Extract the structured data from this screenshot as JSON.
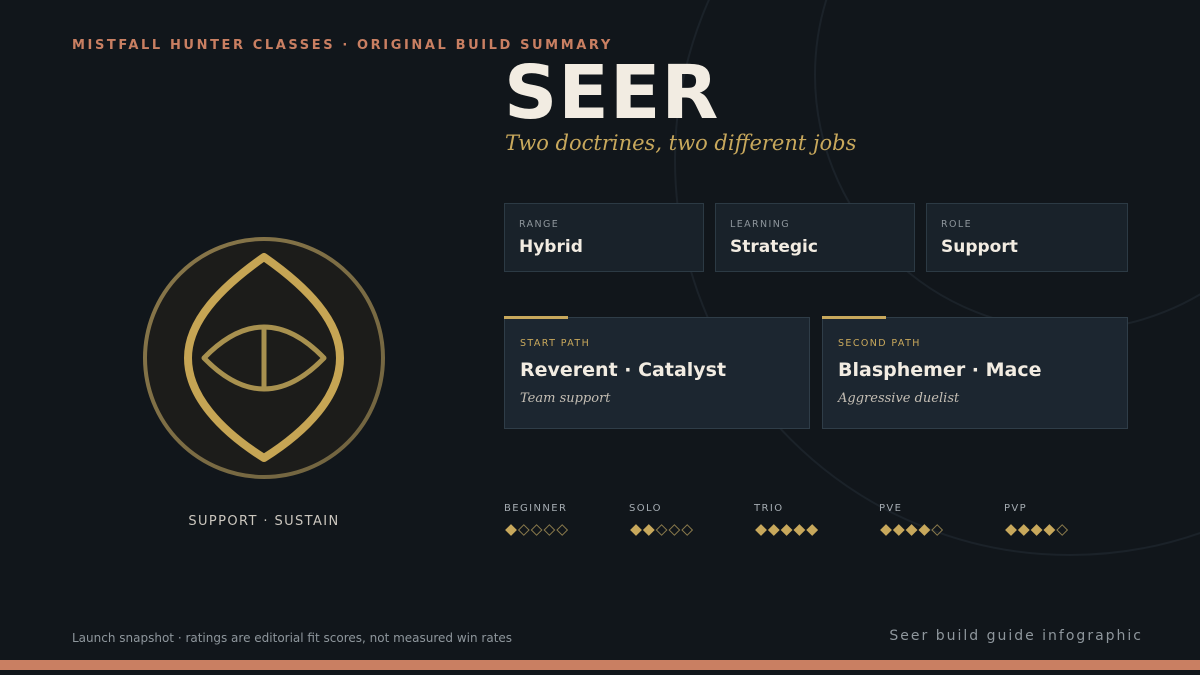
{
  "header": {
    "eyebrow": "MISTFALL HUNTER CLASSES · ORIGINAL BUILD SUMMARY",
    "title": "SEER",
    "subtitle": "Two doctrines, two different jobs"
  },
  "emblem": {
    "icon": "seer-eye-icon",
    "label": "SUPPORT · SUSTAIN"
  },
  "stats": [
    {
      "key": "RANGE",
      "value": "Hybrid"
    },
    {
      "key": "LEARNING",
      "value": "Strategic"
    },
    {
      "key": "ROLE",
      "value": "Support"
    }
  ],
  "paths": [
    {
      "key": "START PATH",
      "name": "Reverent · Catalyst",
      "desc": "Team support"
    },
    {
      "key": "SECOND PATH",
      "name": "Blasphemer · Mace",
      "desc": "Aggressive duelist"
    }
  ],
  "ratings": [
    {
      "label": "BEGINNER",
      "score": 1,
      "max": 5
    },
    {
      "label": "SOLO",
      "score": 2,
      "max": 5
    },
    {
      "label": "TRIO",
      "score": 5,
      "max": 5
    },
    {
      "label": "PVE",
      "score": 4,
      "max": 5
    },
    {
      "label": "PVP",
      "score": 4,
      "max": 5
    }
  ],
  "footer": {
    "note": "Launch snapshot · ratings are editorial fit scores, not measured win rates",
    "credit": "Seer build guide infographic"
  },
  "colors": {
    "background": "#11161b",
    "accent": "#c97f62",
    "gold": "#c8a85c",
    "panel": "#1c2630"
  }
}
